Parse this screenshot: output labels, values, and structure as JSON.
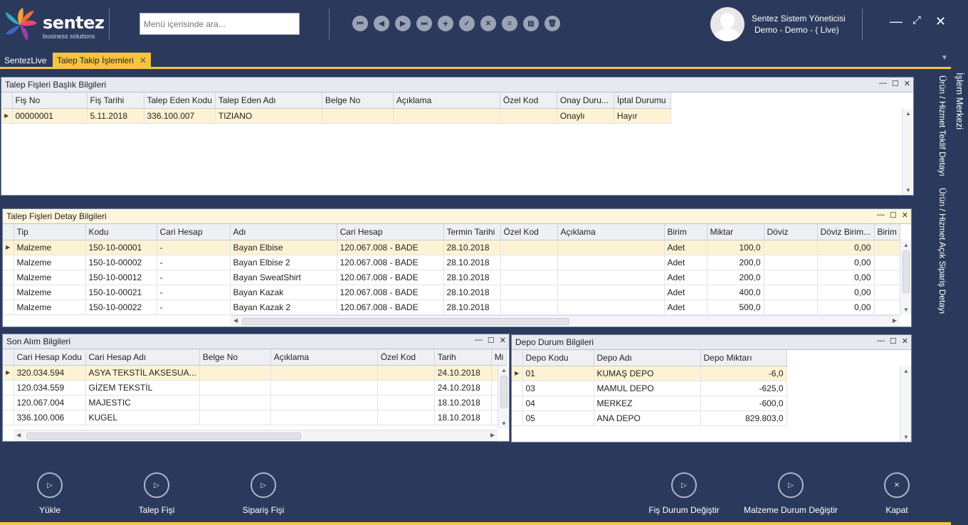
{
  "brand": {
    "name": "sentez",
    "tagline": "business solutions"
  },
  "search": {
    "placeholder": "Menü içerisinde ara..."
  },
  "user": {
    "name": "Sentez Sistem Yöneticisi",
    "context": "Demo - Demo - ( Live)"
  },
  "tabs": [
    {
      "label": "SentezLive"
    },
    {
      "label": "Talep Takip İşlemleri"
    }
  ],
  "side_tabs": [
    "İşlem Merkezi",
    "Ürün / Hizmet Teklif Detayı",
    "Ürün / Hizmet Açık Sipariş Detayı"
  ],
  "header_panel": {
    "title": "Talep Fişleri Başlık Bilgileri",
    "columns": [
      "Fiş No",
      "Fiş Tarihi",
      "Talep Eden Kodu",
      "Talep Eden Adı",
      "Belge No",
      "Açıklama",
      "Özel Kod",
      "Onay Duru...",
      "İptal Durumu"
    ],
    "rows": [
      [
        "00000001",
        "5.11.2018",
        "336.100.007",
        "TIZIANO",
        "",
        "",
        "",
        "Onaylı",
        "Hayır"
      ]
    ]
  },
  "detail_panel": {
    "title": "Talep Fişleri Detay Bilgileri",
    "columns": [
      "Tip",
      "Kodu",
      "Cari Hesap",
      "Adı",
      "Cari Hesap",
      "Termin Tarihi",
      "Özel Kod",
      "Açıklama",
      "Birim",
      "Miktar",
      "Döviz",
      "Döviz Birim...",
      "Birim"
    ],
    "rows": [
      [
        "Malzeme",
        "150-10-00001",
        "-",
        "Bayan Elbise",
        "120.067.008 - BADE",
        "28.10.2018",
        "",
        "",
        "Adet",
        "100,0",
        "",
        "0,00",
        ""
      ],
      [
        "Malzeme",
        "150-10-00002",
        "-",
        "Bayan Elbise 2",
        "120.067.008 - BADE",
        "28.10.2018",
        "",
        "",
        "Adet",
        "200,0",
        "",
        "0,00",
        ""
      ],
      [
        "Malzeme",
        "150-10-00012",
        "-",
        "Bayan SweatShirt",
        "120.067.008 - BADE",
        "28.10.2018",
        "",
        "",
        "Adet",
        "200,0",
        "",
        "0,00",
        ""
      ],
      [
        "Malzeme",
        "150-10-00021",
        "-",
        "Bayan Kazak",
        "120.067.008 - BADE",
        "28.10.2018",
        "",
        "",
        "Adet",
        "400,0",
        "",
        "0,00",
        ""
      ],
      [
        "Malzeme",
        "150-10-00022",
        "-",
        "Bayan Kazak 2",
        "120.067.008 - BADE",
        "28.10.2018",
        "",
        "",
        "Adet",
        "500,0",
        "",
        "0,00",
        ""
      ]
    ]
  },
  "purchase_panel": {
    "title": "Son Alım Bilgileri",
    "columns": [
      "Cari Hesap Kodu",
      "Cari Hesap Adı",
      "Belge No",
      "Açıklama",
      "Özel Kod",
      "Tarih",
      "Mi"
    ],
    "rows": [
      [
        "320.034.594",
        "ASYA TEKSTİL AKSESUA...",
        "",
        "",
        "",
        "24.10.2018",
        ""
      ],
      [
        "120.034.559",
        "GİZEM TEKSTİL",
        "",
        "",
        "",
        "24.10.2018",
        ""
      ],
      [
        "120.067.004",
        "MAJESTIC",
        "",
        "",
        "",
        "18.10.2018",
        ""
      ],
      [
        "336.100.006",
        "KUGEL",
        "",
        "",
        "",
        "18.10.2018",
        ""
      ]
    ]
  },
  "depot_panel": {
    "title": "Depo Durum Bilgileri",
    "columns": [
      "Depo Kodu",
      "Depo Adı",
      "Depo Miktarı"
    ],
    "rows": [
      [
        "01",
        "KUMAŞ DEPO",
        "-6,0"
      ],
      [
        "03",
        "MAMUL DEPO",
        "-625,0"
      ],
      [
        "04",
        "MERKEZ",
        "-600,0"
      ],
      [
        "05",
        "ANA DEPO",
        "829.803,0"
      ]
    ]
  },
  "actions": [
    {
      "label": "Yükle"
    },
    {
      "label": "Talep Fişi"
    },
    {
      "label": "Sipariş Fişi"
    },
    {
      "label": "Fiş Durum Değiştir"
    },
    {
      "label": "Malzeme Durum Değiştir"
    },
    {
      "label": "Kapat"
    }
  ],
  "colors": {
    "background": "#2b3a5c",
    "accent": "#f5c542",
    "selected_row": "#fdf3d4"
  }
}
